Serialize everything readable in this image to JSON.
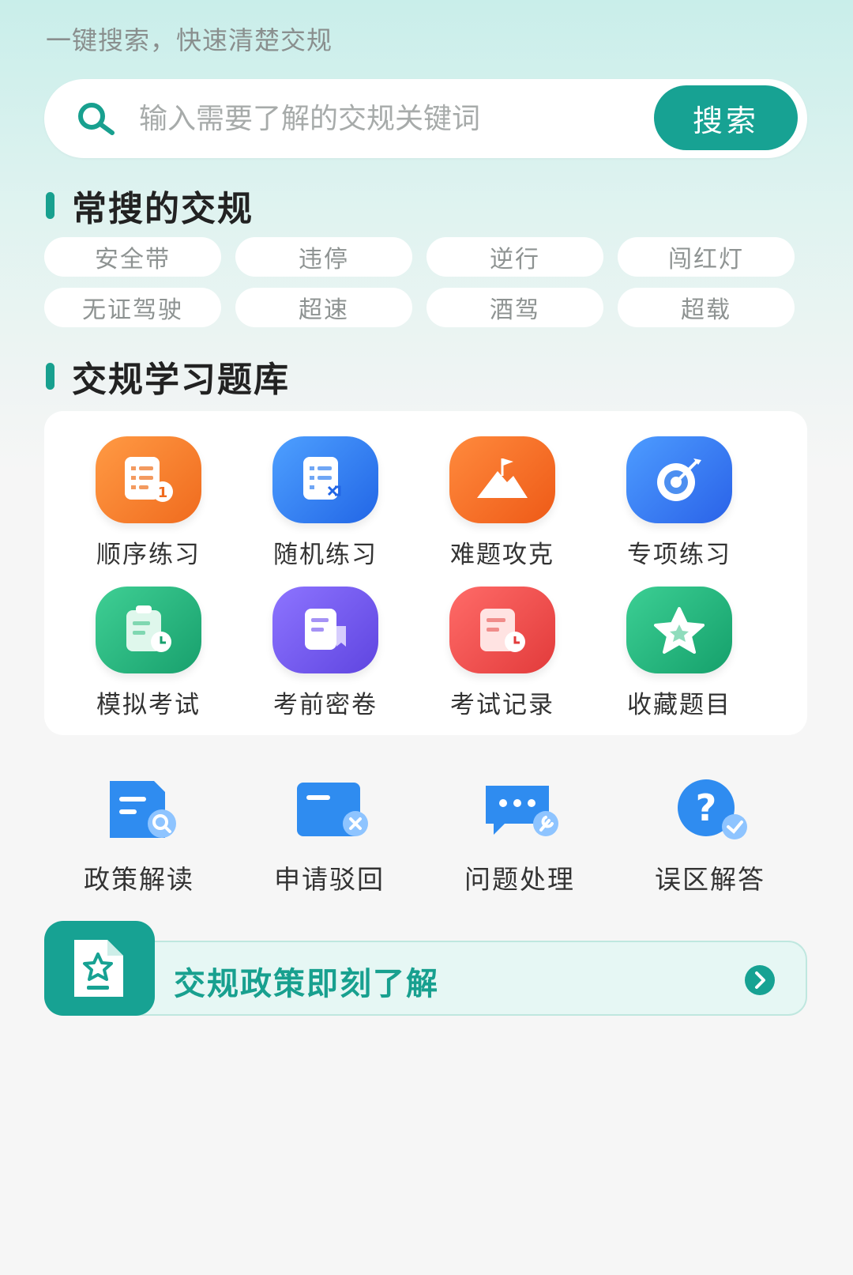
{
  "header": {
    "subtitle": "一键搜索，快速清楚交规"
  },
  "search": {
    "placeholder": "输入需要了解的交规关键词",
    "button_label": "搜索"
  },
  "popular": {
    "title": "常搜的交规",
    "tags": [
      "安全带",
      "违停",
      "逆行",
      "闯红灯",
      "无证驾驶",
      "超速",
      "酒驾",
      "超载"
    ]
  },
  "bank": {
    "title": "交规学习题库",
    "items": [
      {
        "label": "顺序练习",
        "icon": "sequence-practice-icon"
      },
      {
        "label": "随机练习",
        "icon": "random-practice-icon"
      },
      {
        "label": "难题攻克",
        "icon": "mountain-flag-icon"
      },
      {
        "label": "专项练习",
        "icon": "target-icon"
      },
      {
        "label": "模拟考试",
        "icon": "clipboard-clock-icon"
      },
      {
        "label": "考前密卷",
        "icon": "scroll-bookmark-icon"
      },
      {
        "label": "考试记录",
        "icon": "record-clock-icon"
      },
      {
        "label": "收藏题目",
        "icon": "star-icon"
      }
    ]
  },
  "services": [
    {
      "label": "政策解读",
      "icon": "document-search-icon"
    },
    {
      "label": "申请驳回",
      "icon": "window-close-icon"
    },
    {
      "label": "问题处理",
      "icon": "chat-wrench-icon"
    },
    {
      "label": "误区解答",
      "icon": "question-check-icon"
    }
  ],
  "banner": {
    "text": "交规政策即刻了解",
    "icon": "star-document-icon"
  },
  "colors": {
    "accent": "#17a293",
    "orange": "#f47b2e",
    "blue": "#2f7ff0",
    "green": "#22b47d",
    "purple": "#7a5cf0",
    "red": "#ef4b48"
  }
}
